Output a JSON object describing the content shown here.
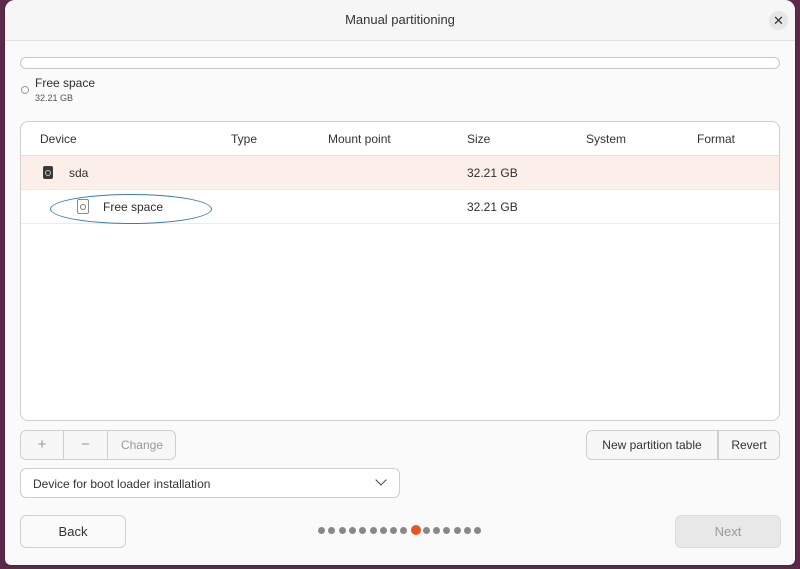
{
  "window": {
    "title": "Manual partitioning",
    "close_glyph": "✕"
  },
  "legend": {
    "name": "Free space",
    "size": "32.21 GB"
  },
  "table": {
    "headers": [
      "Device",
      "Type",
      "Mount point",
      "Size",
      "System",
      "Format"
    ],
    "rows": [
      {
        "device": "sda",
        "size": "32.21 GB",
        "icon": "disk-icon",
        "selected": true
      },
      {
        "device": "Free space",
        "size": "32.21 GB",
        "icon": "free-space-icon",
        "selected": false
      }
    ]
  },
  "toolbar": {
    "add_label": "+",
    "remove_label": "−",
    "change_label": "Change",
    "new_table_label": "New partition table",
    "revert_label": "Revert"
  },
  "bootloader": {
    "label": "Device for boot loader installation"
  },
  "footer": {
    "back_label": "Back",
    "next_label": "Next",
    "step_count": 16,
    "current_step": 10
  },
  "colors": {
    "accent": "#e95420",
    "selected_row": "#fcefea",
    "annotation": "#3a7fa3"
  }
}
